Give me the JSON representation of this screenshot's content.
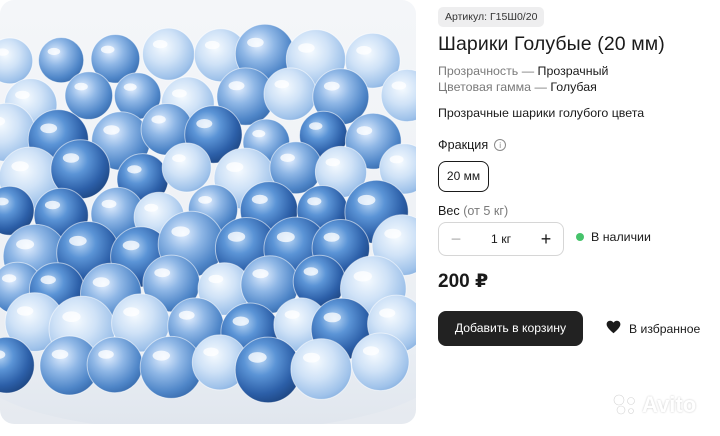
{
  "product": {
    "sku": "Артикул: Г15Ш0/20",
    "title": "Шарики Голубые (20 мм)",
    "props": [
      {
        "name": "Прозрачность",
        "sep": " — ",
        "value": "Прозрачный"
      },
      {
        "name": "Цветовая гамма",
        "sep": " — ",
        "value": "Голубая"
      }
    ],
    "description": "Прозрачные шарики голубого цвета",
    "image_icon": "glass-marbles-photo"
  },
  "fraction": {
    "label": "Фракция",
    "info_icon": "info-icon",
    "options": [
      "20 мм"
    ],
    "selected": "20 мм"
  },
  "weight": {
    "label": "Вес",
    "note": " (от 5 кг)",
    "minus": "−",
    "value": "1 кг",
    "plus": "+"
  },
  "stock": {
    "text": "В наличии",
    "color": "#46c36b"
  },
  "price": "200 ₽",
  "actions": {
    "add_to_cart": "Добавить в корзину",
    "favorite": "В избранное",
    "favorite_icon": "heart-icon"
  },
  "watermark": "Avito",
  "colors": {
    "button_bg": "#222222",
    "stock_dot": "#46c36b",
    "badge_bg": "#eeeeef"
  }
}
